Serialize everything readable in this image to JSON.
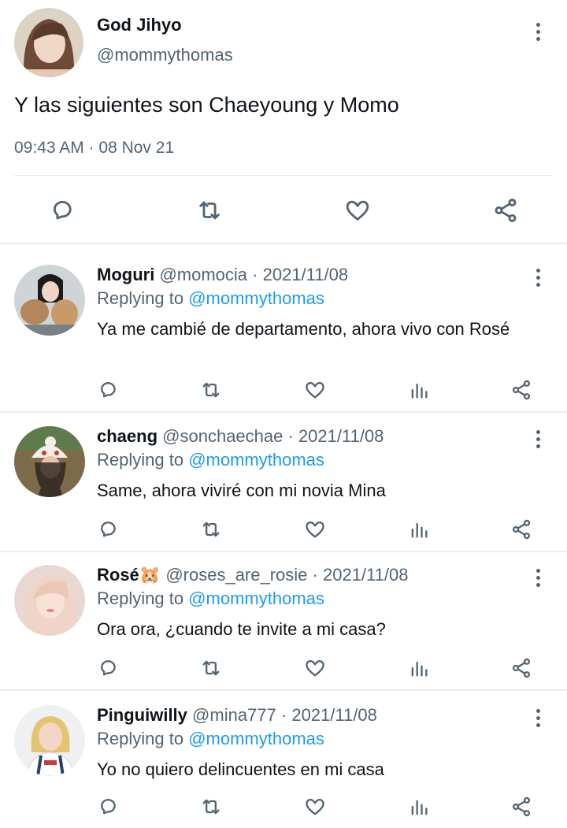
{
  "main_tweet": {
    "name": "God Jihyo",
    "handle": "@mommythomas",
    "text": "Y las siguientes son Chaeyoung y Momo",
    "time": "09:43 AM · 08 Nov 21"
  },
  "replies": [
    {
      "name": "Moguri",
      "handle": "@momocia",
      "date": "· 2021/11/08",
      "replying_prefix": "Replying to",
      "replying_to": "@mommythomas",
      "text": "Ya me cambié de departamento, ahora vivo con Rosé"
    },
    {
      "name": "chaeng",
      "handle": "@sonchaechae",
      "date": "· 2021/11/08",
      "replying_prefix": "Replying to",
      "replying_to": "@mommythomas",
      "text": "Same, ahora viviré con mi novia Mina"
    },
    {
      "name": "Rosé🐹",
      "handle": "@roses_are_rosie",
      "date": "· 2021/11/08",
      "replying_prefix": "Replying to",
      "replying_to": "@mommythomas",
      "text": "Ora ora, ¿cuando te invite a mi casa?"
    },
    {
      "name": "Pinguiwilly",
      "handle": "@mina777",
      "date": "· 2021/11/08",
      "replying_prefix": "Replying to",
      "replying_to": "@mommythomas",
      "text": "Yo no quiero delincuentes en mi casa"
    }
  ],
  "icons": [
    "reply-icon",
    "retweet-icon",
    "like-icon",
    "analytics-icon",
    "share-icon",
    "more-icon"
  ],
  "colors": {
    "link": "#1d9bf0",
    "secondary_text": "#536471",
    "primary_text": "#0f1419"
  }
}
